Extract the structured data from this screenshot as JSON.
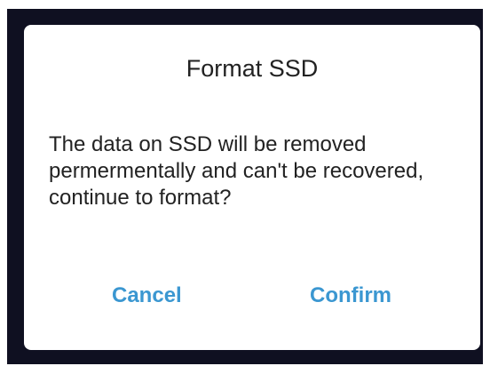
{
  "dialog": {
    "title": "Format SSD",
    "message": "The data on SSD will be removed permermentally and can't be recovered, continue to format?",
    "cancel_label": "Cancel",
    "confirm_label": "Confirm"
  },
  "colors": {
    "backdrop": "#0f1021",
    "dialog_bg": "#ffffff",
    "text": "#222222",
    "accent": "#3b97d1"
  }
}
